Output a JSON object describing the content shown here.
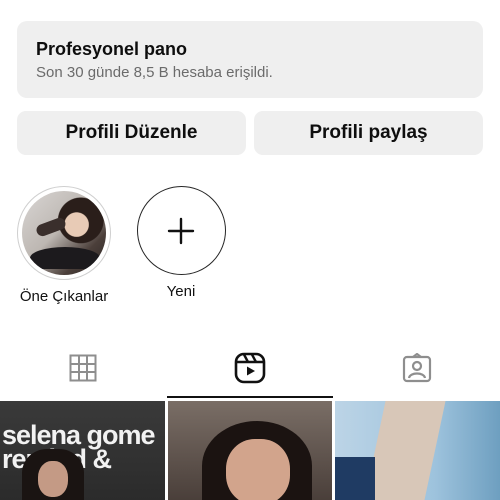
{
  "dashboard": {
    "title": "Profesyonel pano",
    "subtitle": "Son 30 günde 8,5 B hesaba erişildi."
  },
  "actions": {
    "edit_profile": "Profili Düzenle",
    "share_profile": "Profili paylaş"
  },
  "highlights": [
    {
      "label": "Öne Çıkanlar",
      "icon": "highlight-photo"
    },
    {
      "label": "Yeni",
      "icon": "plus-icon"
    }
  ],
  "tabs": [
    {
      "name": "posts",
      "icon": "grid-icon",
      "active": false
    },
    {
      "name": "reels",
      "icon": "reels-icon",
      "active": true
    },
    {
      "name": "tagged",
      "icon": "tagged-icon",
      "active": false
    }
  ],
  "grid": {
    "cell1_text": "selena gome\nremind &"
  },
  "colors": {
    "card_bg": "#efefef",
    "text": "#0e0e0e",
    "subtext": "#6b6b6b"
  }
}
